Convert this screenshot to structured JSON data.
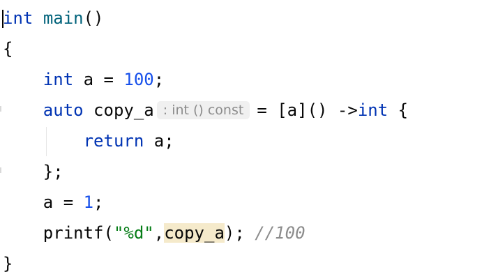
{
  "code": {
    "line1": {
      "type": "int",
      "name": "main",
      "parens": "()"
    },
    "line2": {
      "brace": "{"
    },
    "line3": {
      "type": "int",
      "rest": " a = ",
      "num": "100",
      "end": ";"
    },
    "line4": {
      "kw": "auto",
      "var": " copy_a",
      "hint": ": int () const",
      "rest": "= [a]() ->",
      "ret_type": "int",
      "end": " {"
    },
    "line5": {
      "kw": "return",
      "rest": " a;"
    },
    "line6": {
      "end": "};"
    },
    "line7": {
      "pre": "a = ",
      "num": "1",
      "end": ";"
    },
    "line8": {
      "fn": "printf(",
      "str": "\"%d\"",
      "comma": ",",
      "var": "copy_a",
      "end": "); ",
      "comment": "//100"
    },
    "line9": {
      "brace": "}"
    }
  },
  "colors": {
    "keyword": "#0033b3",
    "function": "#00627a",
    "number": "#1750eb",
    "string": "#067d17",
    "comment": "#8c8c8c",
    "highlight": "#f5eacb"
  }
}
